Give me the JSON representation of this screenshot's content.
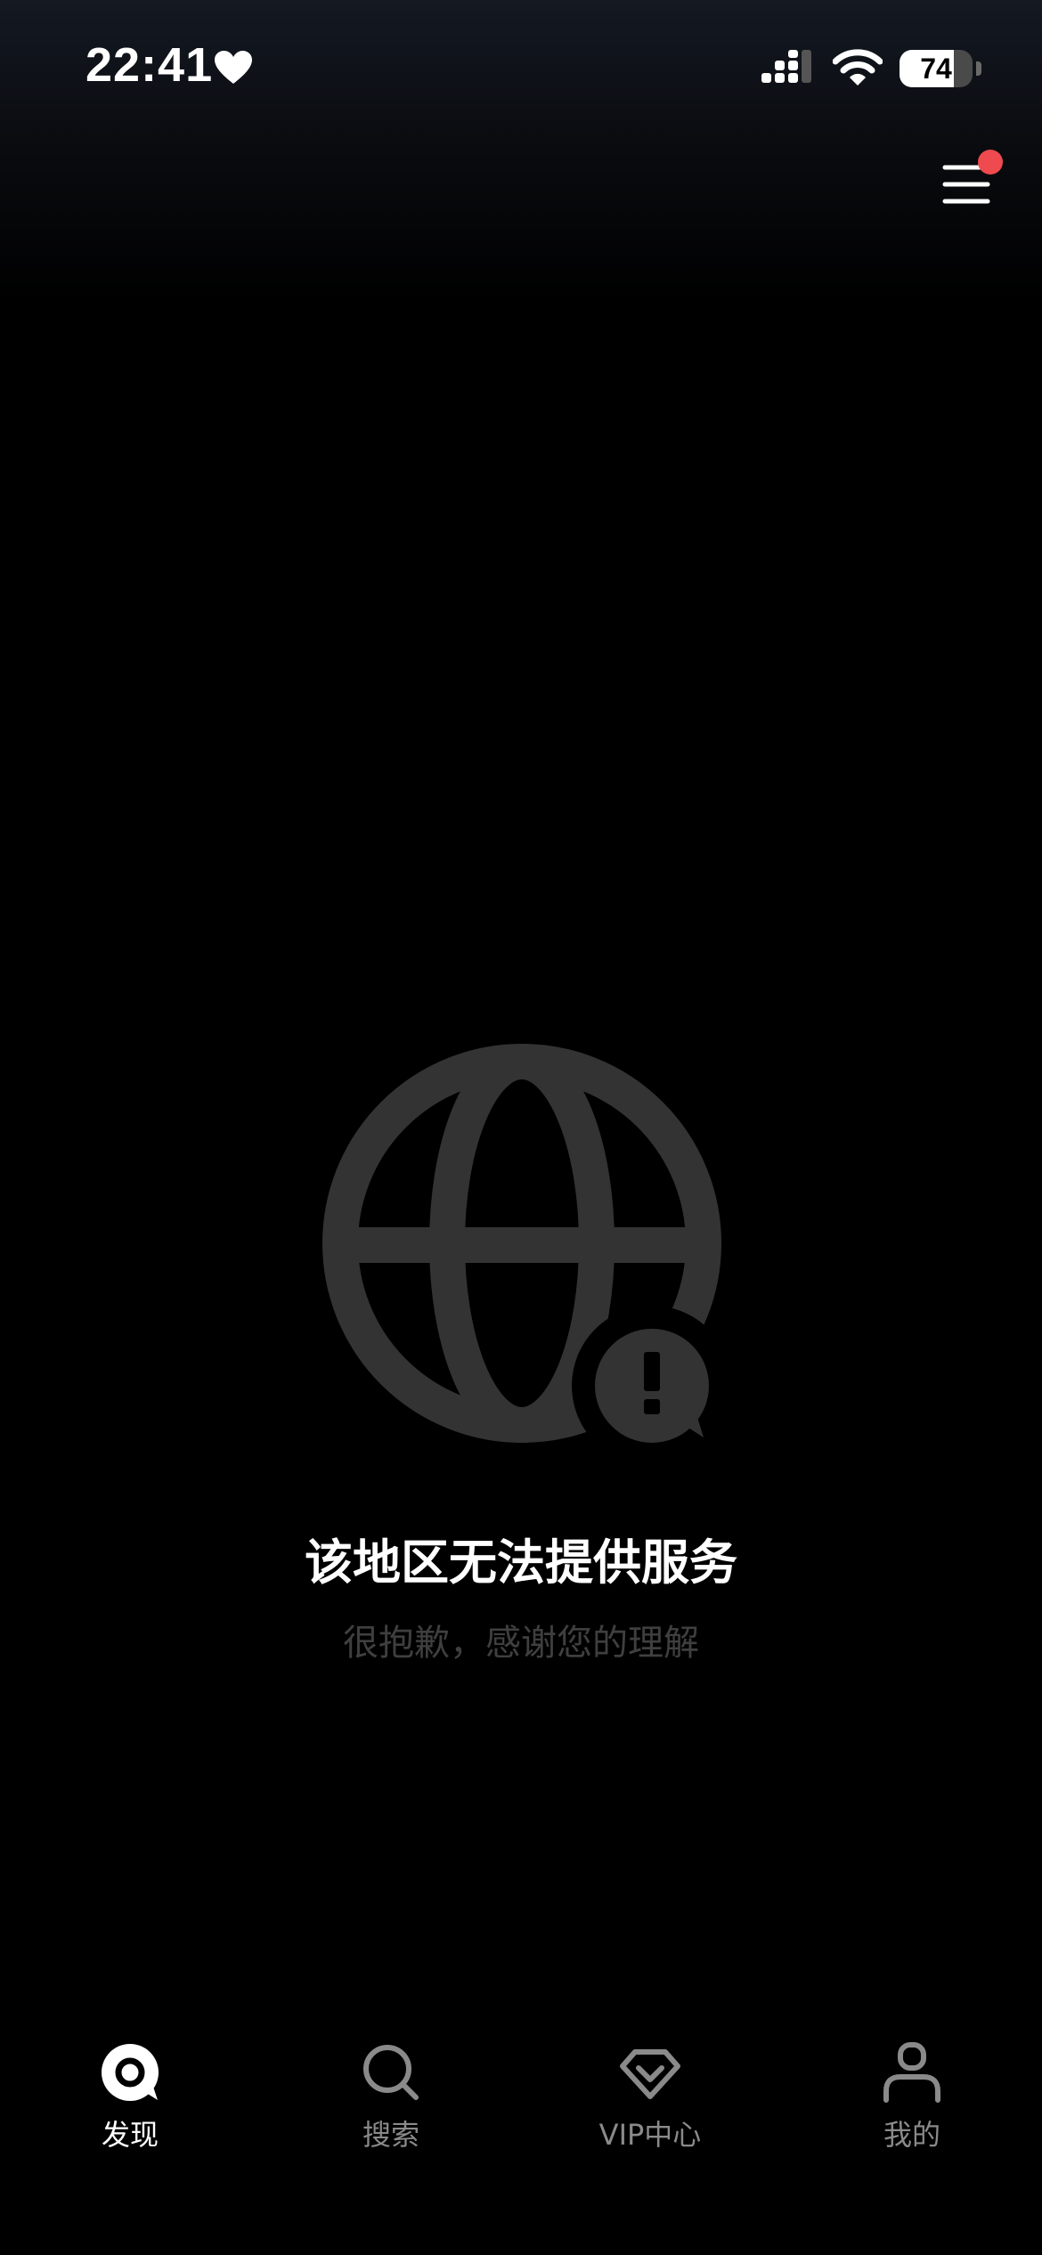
{
  "status_bar": {
    "time": "22:41",
    "battery_level": 74,
    "battery_text": "74"
  },
  "main": {
    "title": "该地区无法提供服务",
    "subtitle": "很抱歉，感谢您的理解"
  },
  "tab_bar": {
    "items": [
      {
        "label": "发现",
        "icon": "discover-icon",
        "active": true
      },
      {
        "label": "搜索",
        "icon": "search-icon",
        "active": false
      },
      {
        "label": "VIP中心",
        "icon": "vip-diamond-icon",
        "active": false
      },
      {
        "label": "我的",
        "icon": "profile-icon",
        "active": false
      }
    ]
  },
  "colors": {
    "background": "#000000",
    "icon_gray": "#333333",
    "notification_dot": "#ee4a4f",
    "tab_inactive": "#8a8a8a",
    "tab_active": "#ffffff"
  }
}
